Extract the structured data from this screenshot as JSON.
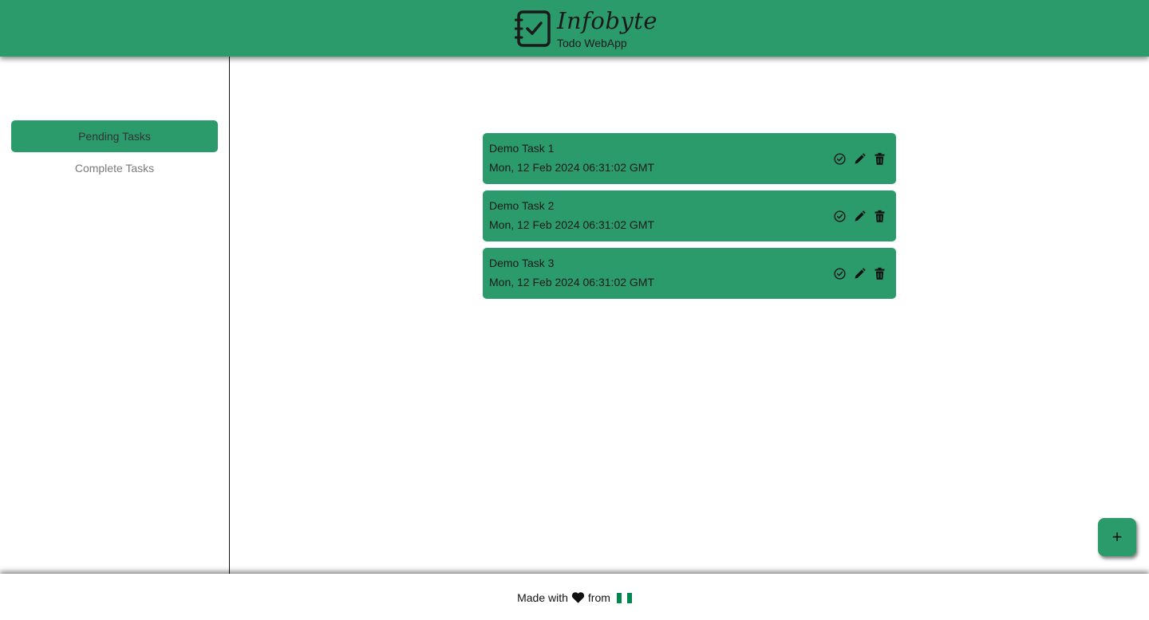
{
  "header": {
    "brand_title": "Infobyte",
    "brand_subtitle": "Todo WebApp",
    "logo_icon": "checklist-notebook-icon",
    "background_color": "#2b9b6b"
  },
  "sidebar": {
    "items": [
      {
        "label": "Pending Tasks",
        "active": true
      },
      {
        "label": "Complete Tasks",
        "active": false
      }
    ]
  },
  "tasks": [
    {
      "title": "Demo Task 1",
      "date": "Mon, 12 Feb 2024 06:31:02 GMT"
    },
    {
      "title": "Demo Task 2",
      "date": "Mon, 12 Feb 2024 06:31:02 GMT"
    },
    {
      "title": "Demo Task 3",
      "date": "Mon, 12 Feb 2024 06:31:02 GMT"
    }
  ],
  "task_action_icons": [
    "check-circle-icon",
    "pencil-icon",
    "trash-icon"
  ],
  "fab": {
    "label": "+",
    "icon": "plus-icon"
  },
  "footer": {
    "made_with": "Made with",
    "from": "from",
    "heart_icon": "heart-icon",
    "flag_icon": "nigeria-flag-icon",
    "flag_colors": [
      "#008751",
      "#ffffff",
      "#008751"
    ]
  }
}
